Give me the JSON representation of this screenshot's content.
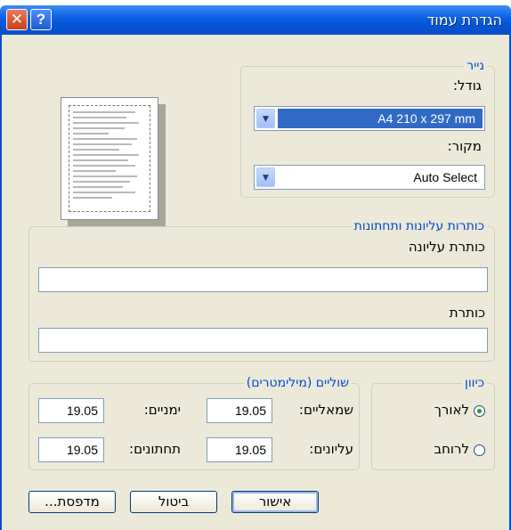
{
  "window": {
    "title": "הגדרת עמוד",
    "close_icon": "close-icon",
    "help_icon": "help-icon"
  },
  "paper": {
    "legend": "נייר",
    "size_label": "גודל:",
    "size_value": "A4 210 x 297 mm",
    "source_label": "מקור:",
    "source_value": "Auto Select"
  },
  "headers": {
    "legend": "כותרות עליונות ותחתונות",
    "header_label": "כותרת עליונה",
    "header_value": "",
    "footer_label": "כותרת",
    "footer_value": ""
  },
  "orientation": {
    "legend": "כיוון",
    "portrait_label": "לאורך",
    "landscape_label": "לרוחב",
    "selected": "portrait"
  },
  "margins": {
    "legend": "שוליים (מילימטרים)",
    "left_label": "שמאליים:",
    "left_value": "19.05",
    "right_label": "ימניים:",
    "right_value": "19.05",
    "top_label": "עליונים:",
    "top_value": "19.05",
    "bottom_label": "תחתונים:",
    "bottom_value": "19.05"
  },
  "buttons": {
    "ok": "אישור",
    "cancel": "ביטול",
    "printer": "מדפסת..."
  },
  "colors": {
    "title_bar": "#0a5ee0",
    "legend_text": "#0046d5",
    "dialog_bg": "#ece9d8",
    "selection": "#316ac5"
  }
}
